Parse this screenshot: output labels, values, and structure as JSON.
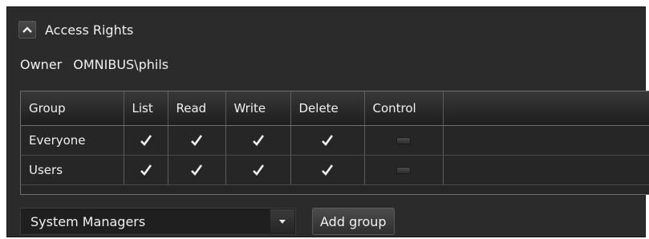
{
  "section": {
    "title": "Access Rights",
    "collapse_icon": "chevron-up-icon"
  },
  "owner": {
    "label": "Owner",
    "value": "OMNIBUS\\phils"
  },
  "table": {
    "columns": [
      "Group",
      "List",
      "Read",
      "Write",
      "Delete",
      "Control",
      ""
    ],
    "rows": [
      {
        "group": "Everyone",
        "list": true,
        "read": true,
        "write": true,
        "delete": true,
        "control": false
      },
      {
        "group": "Users",
        "list": true,
        "read": true,
        "write": true,
        "delete": true,
        "control": false
      }
    ]
  },
  "group_select": {
    "selected": "System Managers",
    "arrow_icon": "chevron-down-icon"
  },
  "add_group_button": {
    "label": "Add group"
  },
  "colors": {
    "panel_bg": "#2b2b2b",
    "text": "#f0f0f0",
    "border": "#6e6e6e"
  }
}
